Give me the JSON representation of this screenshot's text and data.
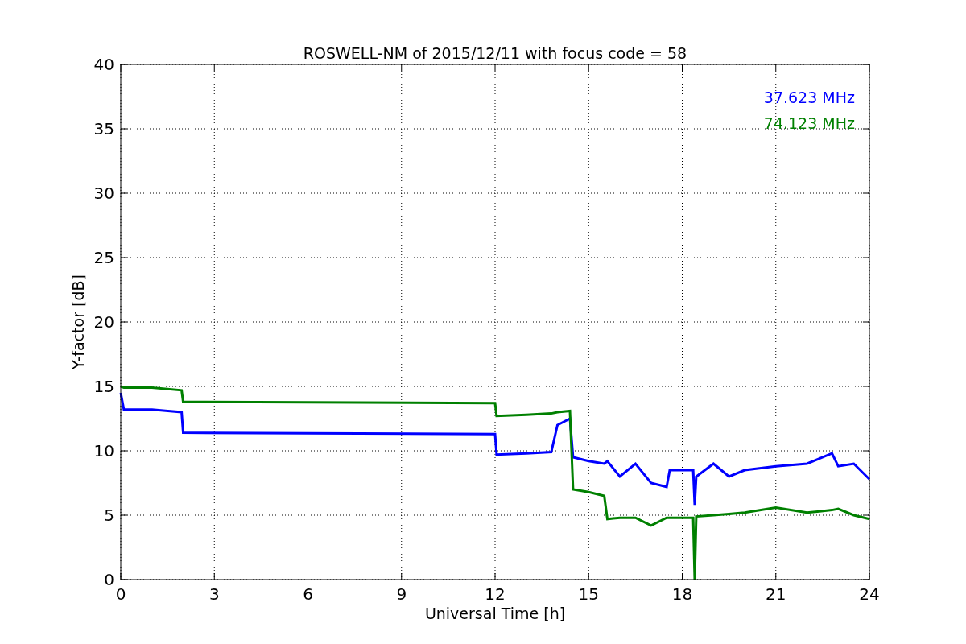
{
  "chart_data": {
    "type": "line",
    "title": "ROSWELL-NM of 2015/12/11 with focus code = 58",
    "xlabel": "Universal Time [h]",
    "ylabel": "Y-factor [dB]",
    "x": [
      0,
      0.1,
      1,
      1.95,
      2,
      12,
      12.05,
      13,
      13.8,
      14,
      14.4,
      14.5,
      15,
      15.5,
      15.6,
      16,
      16.5,
      17,
      17.5,
      17.6,
      18.35,
      18.4,
      18.45,
      19,
      19.5,
      20,
      21,
      22,
      22.8,
      23,
      23.5,
      24
    ],
    "series": [
      {
        "name": "37.623 MHz",
        "color": "#0000ff",
        "values": [
          14.5,
          13.2,
          13.2,
          13.0,
          11.4,
          11.3,
          9.7,
          9.8,
          9.9,
          12.0,
          12.5,
          9.5,
          9.2,
          9.0,
          9.2,
          8.0,
          9.0,
          7.5,
          7.2,
          8.5,
          8.5,
          5.8,
          8.0,
          9.0,
          8.0,
          8.5,
          8.8,
          9.0,
          9.8,
          8.8,
          9.0,
          7.8
        ]
      },
      {
        "name": "74.123 MHz",
        "color": "#008000",
        "values": [
          15.0,
          14.9,
          14.9,
          14.7,
          13.8,
          13.7,
          12.7,
          12.8,
          12.9,
          13.0,
          13.1,
          7.0,
          6.8,
          6.5,
          4.7,
          4.8,
          4.8,
          4.2,
          4.8,
          4.8,
          4.8,
          0,
          4.9,
          5.0,
          5.1,
          5.2,
          5.6,
          5.2,
          5.4,
          5.5,
          5.0,
          4.7
        ]
      }
    ],
    "xlim": [
      0,
      24
    ],
    "ylim": [
      0,
      40
    ],
    "grid": true,
    "xticks": [
      0,
      3,
      6,
      9,
      12,
      15,
      18,
      21,
      24
    ],
    "yticks": [
      0,
      5,
      10,
      15,
      20,
      25,
      30,
      35,
      40
    ]
  }
}
